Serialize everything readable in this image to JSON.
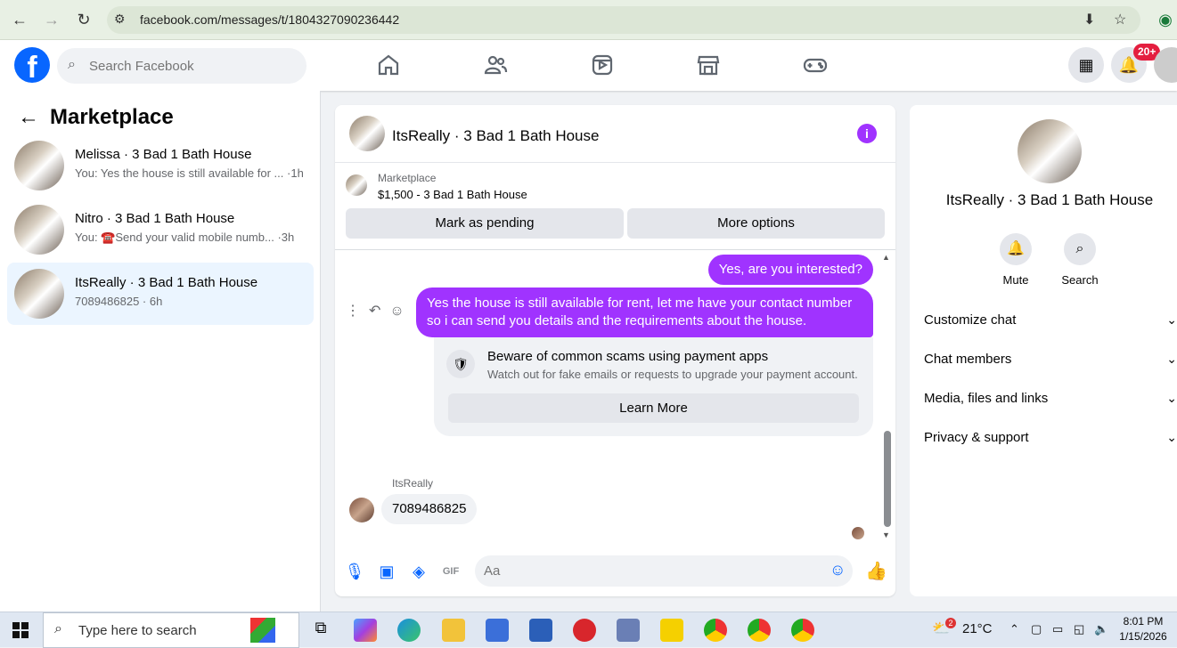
{
  "browser": {
    "url": "facebook.com/messages/t/1804327090236442"
  },
  "header": {
    "search_placeholder": "Search Facebook",
    "notifications_badge": "20+"
  },
  "sidebar": {
    "title": "Marketplace",
    "conversations": [
      {
        "name": "Melissa · 3 Bad 1 Bath House",
        "preview": "You: Yes the house is still available for ... ·1h"
      },
      {
        "name": "Nitro · 3 Bad 1 Bath House",
        "preview": "You: ☎️Send your valid mobile numb... ·3h"
      },
      {
        "name": "ItsReally · 3 Bad 1 Bath House",
        "preview": "7089486825 · 6h"
      }
    ]
  },
  "chat": {
    "title": "ItsReally · 3 Bad 1 Bath House",
    "listing": {
      "label": "Marketplace",
      "price_title": "$1,500 - 3 Bad 1 Bath House"
    },
    "buttons": {
      "mark_pending": "Mark as pending",
      "more_options": "More options"
    },
    "messages": {
      "out1": "Yes, are you interested?",
      "out2_line1": "Yes the house is still available for rent, let me have your contact number",
      "out2_line2": "so i can send you details and the requirements about the house.",
      "sender": "ItsReally",
      "in1": "7089486825"
    },
    "scam_notice": {
      "title": "Beware of common scams using payment apps",
      "body": "Watch out for fake emails or requests to upgrade your payment account.",
      "button": "Learn More"
    },
    "composer_placeholder": "Aa"
  },
  "details": {
    "name": "ItsReally · 3 Bad 1 Bath House",
    "actions": {
      "mute": "Mute",
      "search": "Search"
    },
    "sections": [
      "Customize chat",
      "Chat members",
      "Media, files and links",
      "Privacy & support"
    ]
  },
  "taskbar": {
    "search_placeholder": "Type here to search",
    "weather": "21°C",
    "weather_badge": "2",
    "time": "8:01 PM",
    "date": "1/15/2026"
  },
  "colors": {
    "accent": "#0866ff",
    "bubble_out": "#a033ff"
  }
}
